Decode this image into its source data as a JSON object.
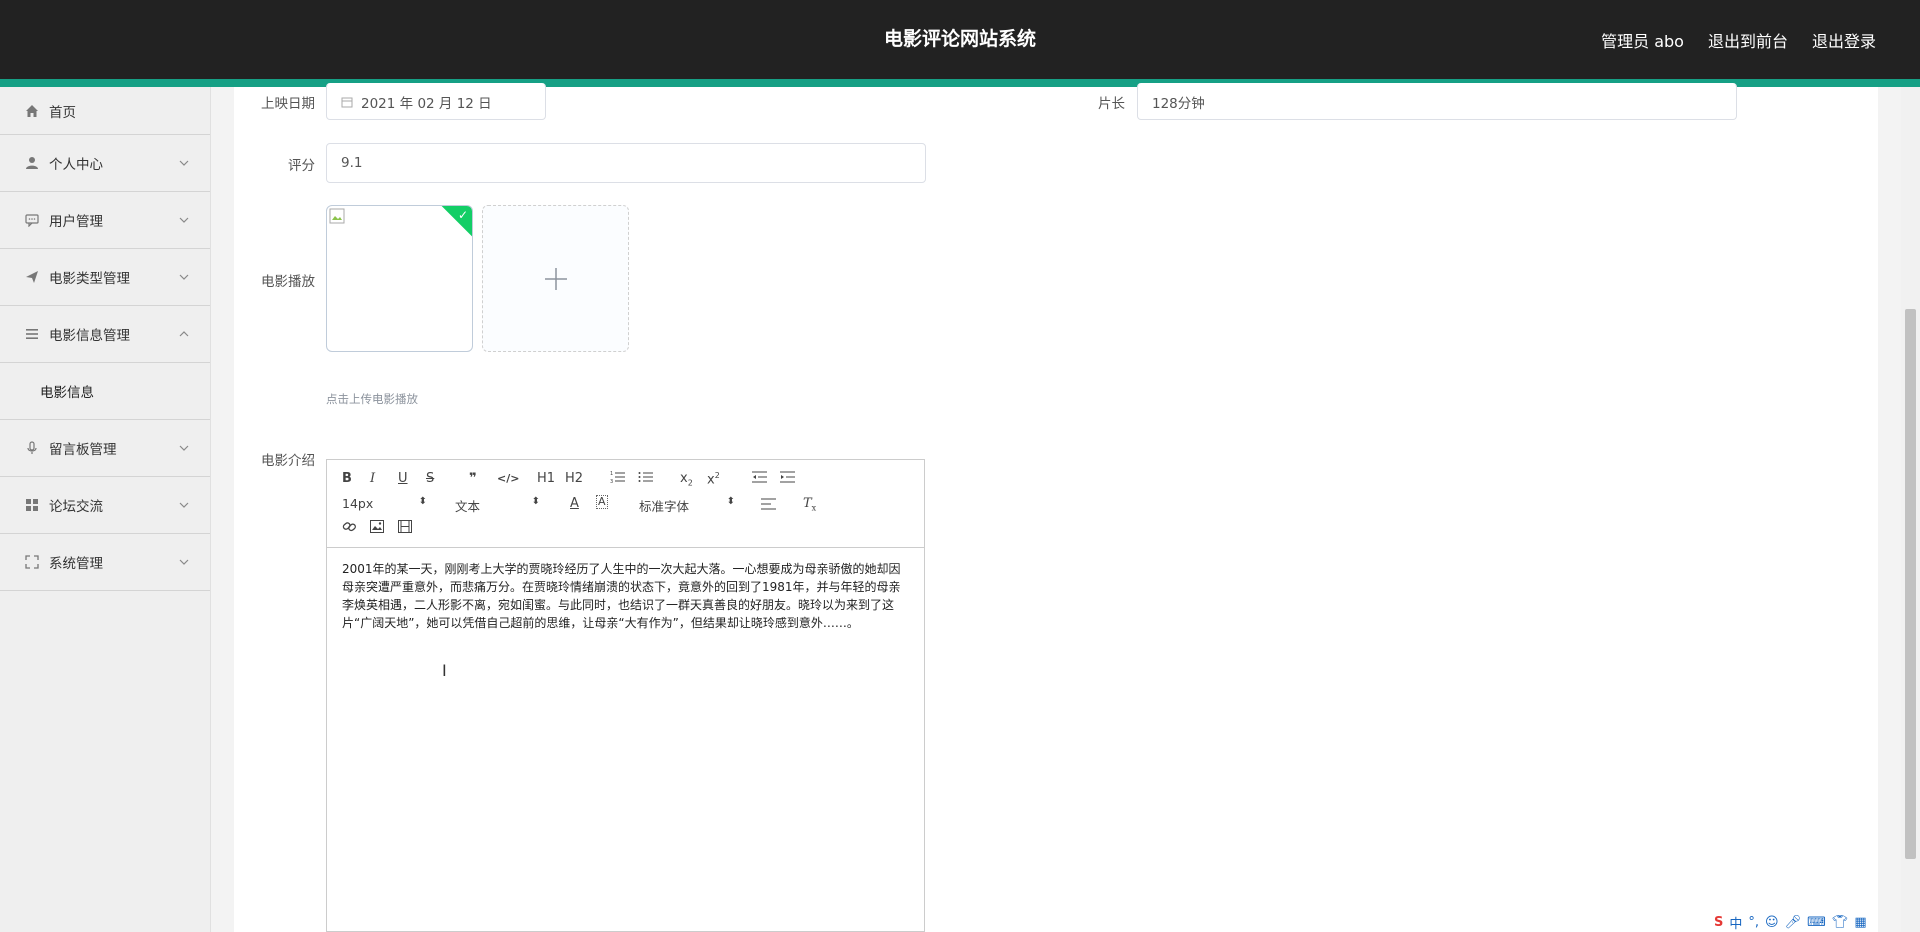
{
  "header": {
    "title": "电影评论网站系统",
    "admin_label": "管理员 abo",
    "frontend_link": "退出到前台",
    "logout_link": "退出登录",
    "accent_color": "#16a085",
    "bar_color": "#222222"
  },
  "sidebar": {
    "items": [
      {
        "label": "首页",
        "icon": "home-icon"
      },
      {
        "label": "个人中心",
        "icon": "user-icon"
      },
      {
        "label": "用户管理",
        "icon": "chat-icon"
      },
      {
        "label": "电影类型管理",
        "icon": "send-icon"
      },
      {
        "label": "电影信息管理",
        "icon": "list-icon"
      },
      {
        "label": "电影信息",
        "icon": ""
      },
      {
        "label": "留言板管理",
        "icon": "mic-icon"
      },
      {
        "label": "论坛交流",
        "icon": "grid-icon"
      },
      {
        "label": "系统管理",
        "icon": "fullscreen-icon"
      }
    ]
  },
  "form": {
    "release_date_label": "上映日期",
    "release_date_value": "2021 年 02 月 12 日",
    "duration_label": "片长",
    "duration_value": "128分钟",
    "rating_label": "评分",
    "rating_value": "9.1",
    "playback_label": "电影播放",
    "upload_hint": "点击上传电影播放",
    "intro_label": "电影介绍"
  },
  "editor": {
    "font_size": "14px",
    "text_format": "文本",
    "font_family": "标准字体",
    "buttons": [
      "B",
      "I",
      "U",
      "S",
      "H1",
      "H2"
    ],
    "content": "2001年的某一天，刚刚考上大学的贾晓玲经历了人生中的一次大起大落。一心想要成为母亲骄傲的她却因母亲突遭严重意外，而悲痛万分。在贾晓玲情绪崩溃的状态下，竟意外的回到了1981年，并与年轻的母亲李焕英相遇，二人形影不离，宛如闺蜜。与此同时，也结识了一群天真善良的好朋友。晓玲以为来到了这片“广阔天地”，她可以凭借自己超前的思维，让母亲“大有作为”，但结果却让晓玲感到意外……。"
  },
  "tray": {
    "ime": "中"
  }
}
